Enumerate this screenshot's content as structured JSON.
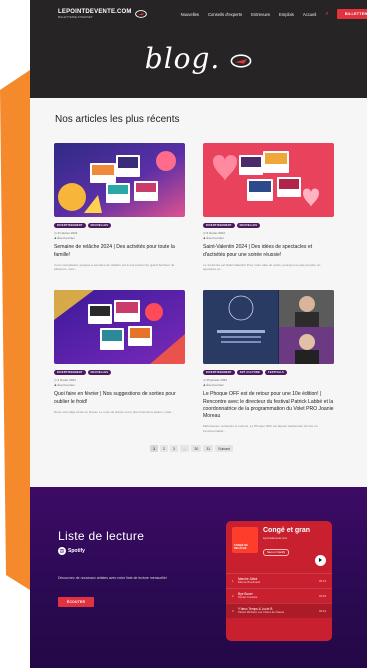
{
  "header": {
    "logo": {
      "name": "LEPOINTDEVENTE.COM",
      "tagline": "BILLETTERIE INTERNET"
    },
    "nav": [
      "Nouvelles",
      "Conseils d'experts",
      "Entrevues",
      "Emplois",
      "Accueil"
    ],
    "cta_label": "BILLETTERIE",
    "page_title": "blog."
  },
  "main": {
    "section_title": "Nos articles les plus récents",
    "articles": [
      {
        "tags": [
          "DIVERTISSEMENT",
          "NOUVELLES"
        ],
        "date": "21 février 2024",
        "author": "Ève Fournier",
        "title": "Semaine de relâche 2024 | Des activités pour toute la famille!",
        "excerpt": "Il est connaissant, puisque a semaine de relâche est à nos portes! Au grand bonheur de plusieurs, voici..."
      },
      {
        "tags": [
          "DIVERTISSEMENT",
          "NOUVELLES"
        ],
        "date": "9 février 2024",
        "author": "Ève Fournier",
        "title": "Saint-Valentin 2024 | Des idées de spectacles et d'activités pour une soirée réussie!",
        "excerpt": "Le 14 février est Saint-Valentin! Pour notre idée de sortie, pourquoi ne pas prendre un spectacle en..."
      },
      {
        "tags": [
          "DIVERTISSEMENT",
          "NOUVELLES"
        ],
        "date": "2 février 2024",
        "author": "Ève Fournier",
        "title": "Quoi faire en février | Nos suggestions de sorties pour oublier le froid!",
        "excerpt": "Nous voici déjà rendu en février. Le mois de février est le plus froid de la saison, mais..."
      },
      {
        "tags": [
          "DIVERTISSEMENT",
          "ART CULTURE",
          "FESTIVALS"
        ],
        "date": "25 janvier 2024",
        "author": "Ève Fournier",
        "title": "Le Phoque OFF est de retour pour une 10e édition! | Rencontre avec le directeur du festival Patrick Labbé et la coordonnatrice de la programmation du Volet PRO Joanie Moreau",
        "excerpt": "Mélomanes, curieuses et curieux, Le Phoque OFF est depuis maintenant 10 ans un incontournable..."
      }
    ],
    "pagination": [
      "1",
      "2",
      "3",
      "…",
      "30",
      "31",
      "Suivant"
    ]
  },
  "playlist": {
    "title": "Liste de lecture",
    "provider": "Spotify",
    "description": "Découvrez de nouveaux artistes avec notre liste de lecture mensuelle!",
    "button_label": "ÉCOUTER",
    "widget": {
      "cover_text": "CONGÉ DE RELÂCHE",
      "name": "Congé et gran",
      "owner": "lepointdevente.com",
      "save_label": "Save on Spotify",
      "tracks": [
        {
          "n": "1",
          "title": "Marche Jâbot",
          "artist": "Étienne Boudreault",
          "dur": "03:13"
        },
        {
          "n": "2",
          "title": "Bye Boxer",
          "artist": "Sylvain Cossette",
          "dur": "03:53"
        },
        {
          "n": "3",
          "title": "Y'deux Temps & Lucie B.",
          "artist": "Patrice Michaud, Les Chiens de Chasse",
          "dur": "04:21"
        }
      ]
    }
  },
  "colors": {
    "header_bg": "#262424",
    "accent": "#e2323f",
    "tag_bg": "#4b1a5c",
    "side_shape": "#f58a2c",
    "playlist_bg": "#3d0b66",
    "spotify_card": "#c8202f"
  }
}
